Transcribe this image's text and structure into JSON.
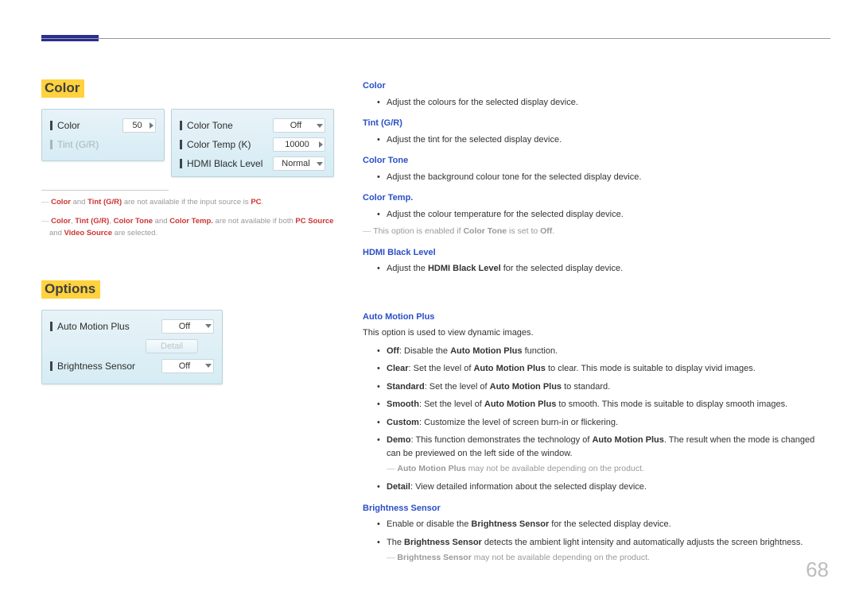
{
  "page_number": "68",
  "sections": {
    "color_title": "Color",
    "options_title": "Options"
  },
  "panels": {
    "color": {
      "color_label": "Color",
      "color_value": "50",
      "tint_label": "Tint (G/R)"
    },
    "tone": {
      "colortone_label": "Color Tone",
      "colortone_value": "Off",
      "colortemp_label": "Color Temp (K)",
      "colortemp_value": "10000",
      "hdmiblack_label": "HDMI Black Level",
      "hdmiblack_value": "Normal"
    },
    "options": {
      "amp_label": "Auto Motion Plus",
      "amp_value": "Off",
      "detail_btn": "Detail",
      "bright_label": "Brightness Sensor",
      "bright_value": "Off"
    }
  },
  "footnotes": {
    "f1_a": "Color",
    "f1_b": " and ",
    "f1_c": "Tint (G/R)",
    "f1_d": " are not available if the input source is ",
    "f1_e": "PC",
    "f1_f": ".",
    "f2_a": "Color",
    "f2_b": ", ",
    "f2_c": "Tint (G/R)",
    "f2_d": ", ",
    "f2_e": "Color Tone",
    "f2_f": " and ",
    "f2_g": "Color Temp.",
    "f2_h": " are not available if both ",
    "f2_i": "PC Source",
    "f2_j": " and ",
    "f2_k": "Video Source",
    "f2_l": " are selected."
  },
  "right": {
    "color_h": "Color",
    "color_li": "Adjust the colours for the selected display device.",
    "tint_h": "Tint (G/R)",
    "tint_li": "Adjust the tint for the selected display device.",
    "ctone_h": "Color Tone",
    "ctone_li": "Adjust the background colour tone for the selected display device.",
    "ctemp_h": "Color Temp.",
    "ctemp_li": "Adjust the colour temperature for the selected display device.",
    "ctemp_note_a": "This option is enabled if ",
    "ctemp_note_b": "Color Tone",
    "ctemp_note_c": " is set to ",
    "ctemp_note_d": "Off",
    "ctemp_note_e": ".",
    "hdmi_h": "HDMI Black Level",
    "hdmi_li_a": "Adjust the ",
    "hdmi_li_b": "HDMI Black Level",
    "hdmi_li_c": " for the selected display device.",
    "amp_h": "Auto Motion Plus",
    "amp_intro": "This option is used to view dynamic images.",
    "amp_off_a": "Off",
    "amp_off_b": ": Disable the ",
    "amp_off_c": "Auto Motion Plus",
    "amp_off_d": " function.",
    "amp_clear_a": "Clear",
    "amp_clear_b": ": Set the level of ",
    "amp_clear_c": "Auto Motion Plus",
    "amp_clear_d": " to clear. This mode is suitable to display vivid images.",
    "amp_std_a": "Standard",
    "amp_std_b": ": Set the level of ",
    "amp_std_c": "Auto Motion Plus",
    "amp_std_d": " to standard.",
    "amp_sm_a": "Smooth",
    "amp_sm_b": ": Set the level of ",
    "amp_sm_c": "Auto Motion Plus",
    "amp_sm_d": " to smooth. This mode is suitable to display smooth images.",
    "amp_cu_a": "Custom",
    "amp_cu_b": ": Customize the level of screen burn-in or flickering.",
    "amp_demo_a": "Demo",
    "amp_demo_b": ": This function demonstrates the technology of ",
    "amp_demo_c": "Auto Motion Plus",
    "amp_demo_d": ". The result when the mode is changed can be previewed on the left side of the window.",
    "amp_note_a": "Auto Motion Plus",
    "amp_note_b": " may not be available depending on the product.",
    "amp_det_a": "Detail",
    "amp_det_b": ": View detailed information about the selected display device.",
    "bs_h": "Brightness Sensor",
    "bs_li1_a": "Enable or disable the ",
    "bs_li1_b": "Brightness Sensor",
    "bs_li1_c": " for the selected display device.",
    "bs_li2_a": "The ",
    "bs_li2_b": "Brightness Sensor",
    "bs_li2_c": " detects the ambient light intensity and automatically adjusts the screen brightness.",
    "bs_note_a": "Brightness Sensor",
    "bs_note_b": " may not be available depending on the product."
  }
}
